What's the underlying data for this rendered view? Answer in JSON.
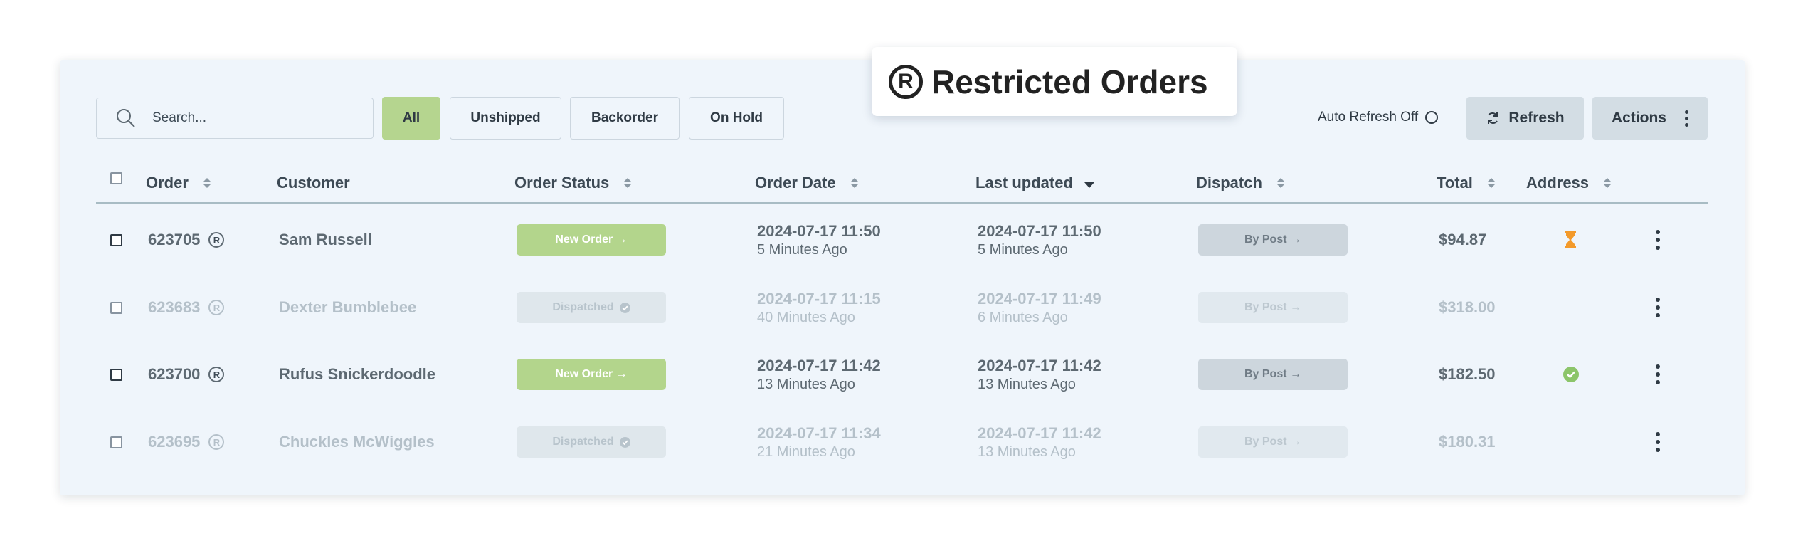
{
  "title": "Restricted Orders",
  "title_icon": "registered-icon",
  "search": {
    "placeholder": "Search..."
  },
  "filters": [
    "All",
    "Unshipped",
    "Backorder",
    "On Hold"
  ],
  "active_filter": "All",
  "auto_refresh_label": "Auto Refresh Off",
  "refresh_label": "Refresh",
  "actions_label": "Actions",
  "columns": {
    "order": "Order",
    "customer": "Customer",
    "status": "Order Status",
    "order_date": "Order Date",
    "last_updated": "Last updated",
    "dispatch": "Dispatch",
    "total": "Total",
    "address": "Address"
  },
  "rows": [
    {
      "id": "623705",
      "customer": "Sam Russell",
      "status": "New Order →",
      "order_date": "2024-07-17 11:50",
      "order_ago": "5 Minutes Ago",
      "updated_date": "2024-07-17 11:50",
      "updated_ago": "5 Minutes Ago",
      "dispatch": "By Post →",
      "total": "$94.87",
      "address_icon": "hourglass-icon"
    },
    {
      "id": "623683",
      "customer": "Dexter Bumblebee",
      "status": "Dispatched",
      "order_date": "2024-07-17 11:15",
      "order_ago": "40 Minutes Ago",
      "updated_date": "2024-07-17 11:49",
      "updated_ago": "6 Minutes Ago",
      "dispatch": "By Post →",
      "total": "$318.00",
      "address_icon": ""
    },
    {
      "id": "623700",
      "customer": "Rufus Snickerdoodle",
      "status": "New Order →",
      "order_date": "2024-07-17 11:42",
      "order_ago": "13 Minutes Ago",
      "updated_date": "2024-07-17 11:42",
      "updated_ago": "13 Minutes Ago",
      "dispatch": "By Post →",
      "total": "$182.50",
      "address_icon": "check-circle-icon"
    },
    {
      "id": "623695",
      "customer": "Chuckles McWiggles",
      "status": "Dispatched",
      "order_date": "2024-07-17 11:34",
      "order_ago": "21 Minutes Ago",
      "updated_date": "2024-07-17 11:42",
      "updated_ago": "13 Minutes Ago",
      "dispatch": "By Post →",
      "total": "$180.31",
      "address_icon": ""
    }
  ],
  "colors": {
    "accent_green": "#b5d58f",
    "panel_bg": "#eff5fb",
    "hourglass": "#f39a2b",
    "check": "#8cc56a"
  }
}
